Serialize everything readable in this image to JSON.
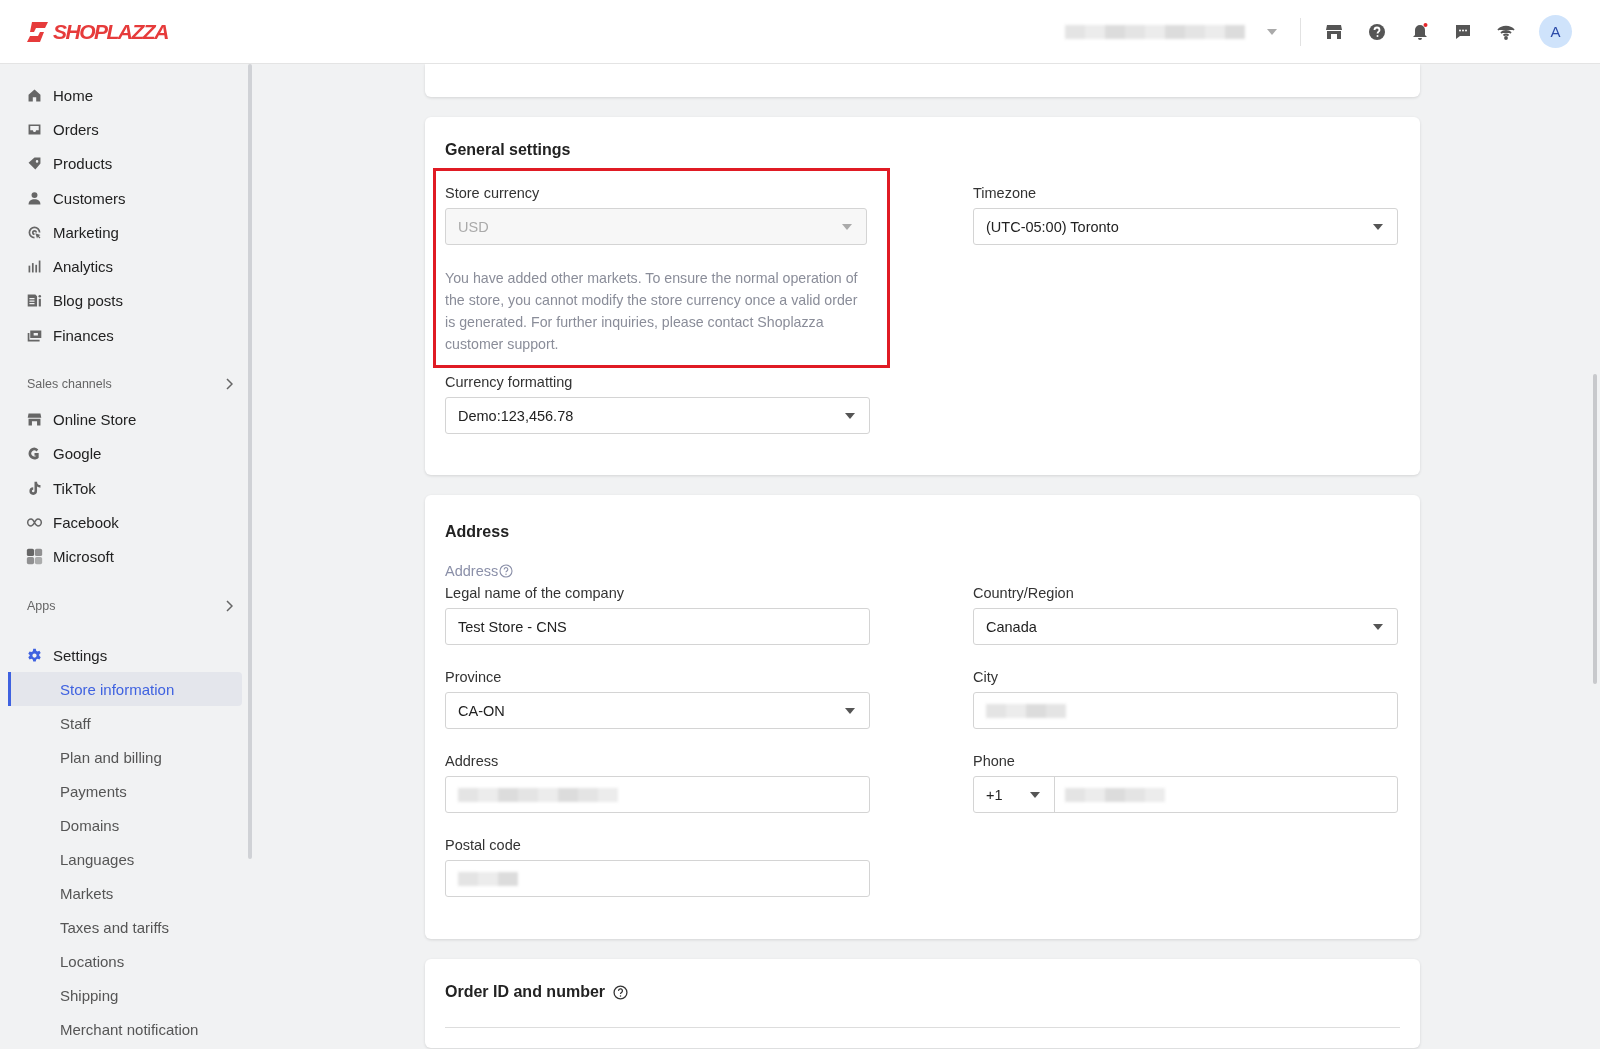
{
  "header": {
    "logo": "SHOPLAZZA",
    "notification_dot": true,
    "avatar": "A"
  },
  "sidebar": {
    "main": [
      {
        "label": "Home"
      },
      {
        "label": "Orders"
      },
      {
        "label": "Products"
      },
      {
        "label": "Customers"
      },
      {
        "label": "Marketing"
      },
      {
        "label": "Analytics"
      },
      {
        "label": "Blog posts"
      },
      {
        "label": "Finances"
      }
    ],
    "sections": [
      {
        "title": "Sales channels",
        "items": [
          {
            "label": "Online Store"
          },
          {
            "label": "Google"
          },
          {
            "label": "TikTok"
          },
          {
            "label": "Facebook"
          },
          {
            "label": "Microsoft"
          }
        ]
      },
      {
        "title": "Apps"
      }
    ],
    "settings": {
      "label": "Settings",
      "children": [
        {
          "label": "Store information",
          "selected": true
        },
        {
          "label": "Staff",
          "selected": false
        },
        {
          "label": "Plan and billing",
          "selected": false
        },
        {
          "label": "Payments",
          "selected": false
        },
        {
          "label": "Domains",
          "selected": false
        },
        {
          "label": "Languages",
          "selected": false
        },
        {
          "label": "Markets",
          "selected": false
        },
        {
          "label": "Taxes and tariffs",
          "selected": false
        },
        {
          "label": "Locations",
          "selected": false
        },
        {
          "label": "Shipping",
          "selected": false
        },
        {
          "label": "Merchant notification",
          "selected": false
        }
      ]
    }
  },
  "general_settings": {
    "title": "General settings",
    "store_currency": {
      "label": "Store currency",
      "value": "USD",
      "disabled": true,
      "highlighted": true,
      "note": "You have added other markets. To ensure the normal operation of the store, you cannot modify the store currency once a valid order is generated. For further inquiries, please contact Shoplazza customer support."
    },
    "timezone": {
      "label": "Timezone",
      "value": "(UTC-05:00) Toronto"
    },
    "currency_formatting": {
      "label": "Currency formatting",
      "value": "Demo:123,456.78"
    }
  },
  "address": {
    "title": "Address",
    "hint": "Address",
    "fields": [
      {
        "label": "Legal name of the company",
        "kind": "text",
        "value": "Test Store - CNS"
      },
      {
        "label": "Country/Region",
        "kind": "select",
        "value": "Canada"
      },
      {
        "label": "Province",
        "kind": "select",
        "value": "CA-ON"
      },
      {
        "label": "City",
        "kind": "text"
      },
      {
        "label": "Address",
        "kind": "text"
      },
      {
        "label": "Phone",
        "kind": "phone",
        "code": "+1"
      },
      {
        "label": "Postal code",
        "kind": "text"
      }
    ]
  },
  "order_id": {
    "title": "Order ID and number"
  }
}
